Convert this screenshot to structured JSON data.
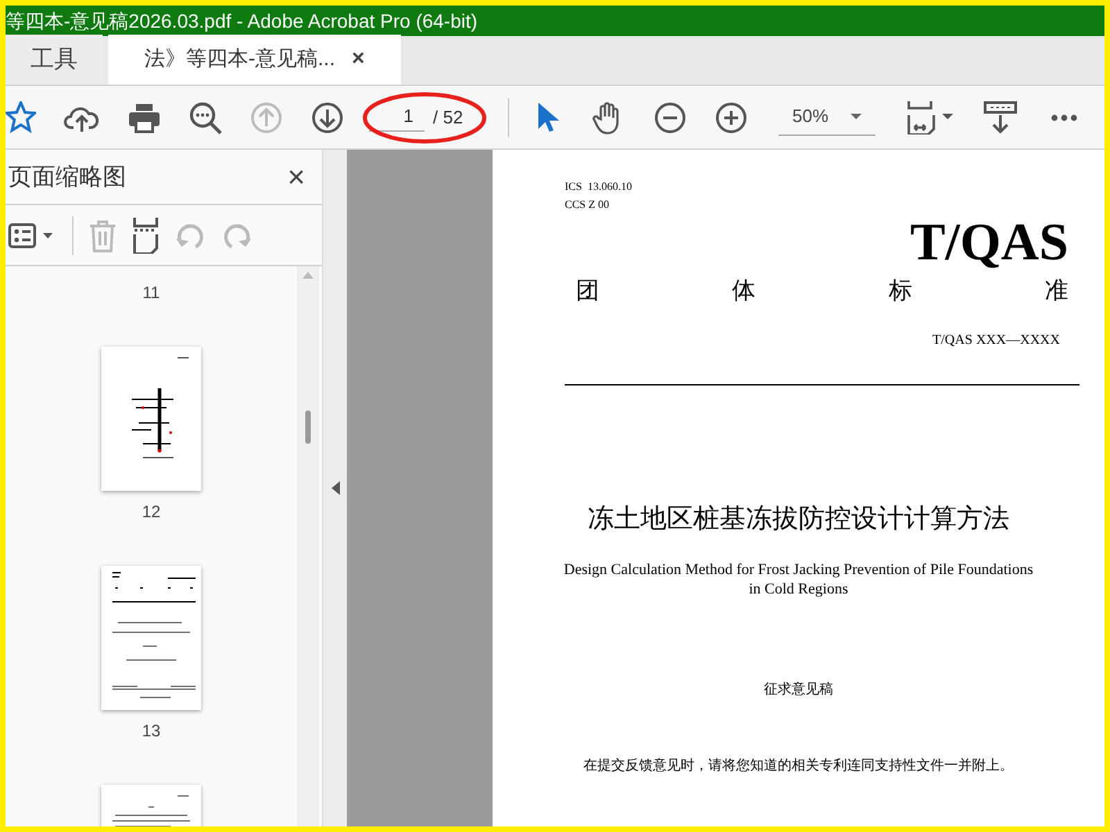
{
  "window": {
    "title": "等四本-意见稿2026.03.pdf - Adobe Acrobat Pro (64-bit)"
  },
  "tabs": [
    {
      "label": "工具",
      "selected": false
    },
    {
      "label": "法》等四本-意见稿...",
      "selected": true,
      "close": "×"
    }
  ],
  "toolbar": {
    "page_input": "1",
    "page_count": "/ 52",
    "zoom": "50%",
    "tools": [
      {
        "kind": "pointer",
        "selected": true
      },
      {
        "kind": "hand",
        "selected": false
      }
    ]
  },
  "sidebar": {
    "title": "页面缩略图",
    "close": "×",
    "page_labels": [
      "11",
      "12",
      "13"
    ]
  },
  "document": {
    "ics": "ICS  13.060.10",
    "ccs": "CCS Z 00",
    "logo": "T/QAS",
    "category": [
      "团",
      "体",
      "标",
      "准"
    ],
    "code": "T/QAS XXX—XXXX",
    "title_zh": "冻土地区桩基冻拔防控设计计算方法",
    "title_en": "Design Calculation Method for Frost Jacking Prevention of Pile Foundations in Cold Regions",
    "stage": "征求意见稿",
    "notice": "在提交反馈意见时，请将您知道的相关专利连同支持性文件一并附上。"
  }
}
